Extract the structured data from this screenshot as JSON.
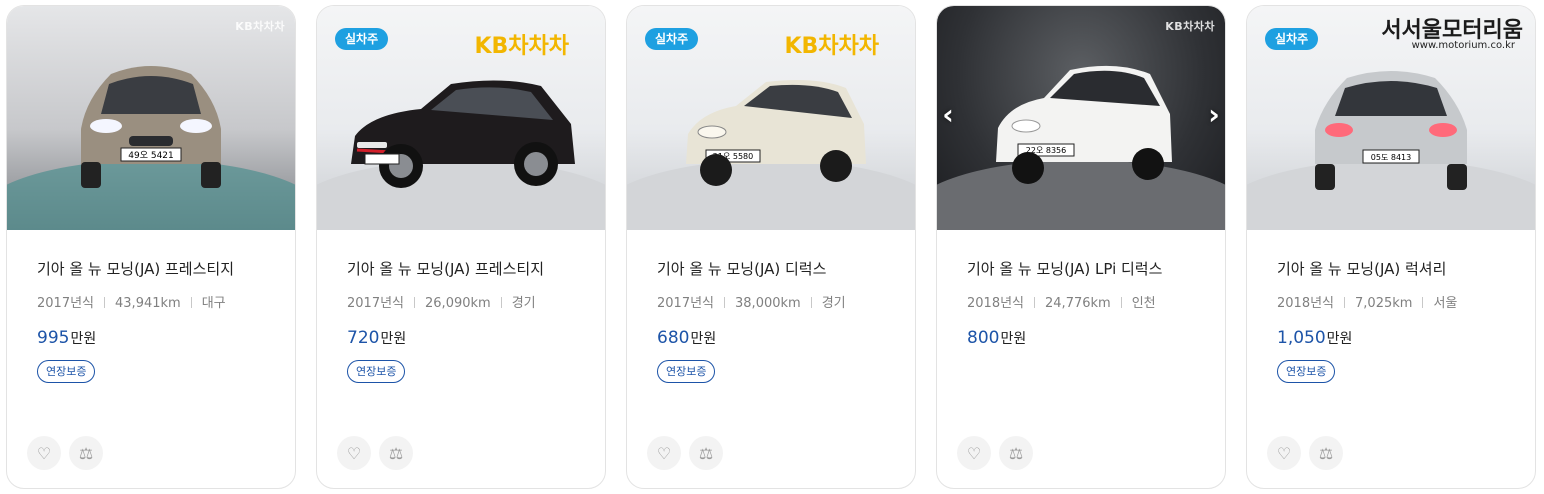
{
  "listings": [
    {
      "title": "기아 올 뉴 모닝(JA) 프레스티지",
      "year": "2017년식",
      "mileage": "43,941km",
      "region": "대구",
      "price": "995",
      "price_unit": "만원",
      "tag": "연장보증",
      "badge": "",
      "watermark": "KB차차차",
      "car_color": "#9a8f80",
      "plate": "49오 5421"
    },
    {
      "title": "기아 올 뉴 모닝(JA) 프레스티지",
      "year": "2017년식",
      "mileage": "26,090km",
      "region": "경기",
      "price": "720",
      "price_unit": "만원",
      "tag": "연장보증",
      "badge": "실차주",
      "watermark": "KB차차차",
      "car_color": "#1e1b1d"
    },
    {
      "title": "기아 올 뉴 모닝(JA) 디럭스",
      "year": "2017년식",
      "mileage": "38,000km",
      "region": "경기",
      "price": "680",
      "price_unit": "만원",
      "tag": "연장보증",
      "badge": "실차주",
      "watermark": "KB차차차",
      "car_color": "#e8e4d6",
      "plate": "21오 5580"
    },
    {
      "title": "기아 올 뉴 모닝(JA) LPi 디럭스",
      "year": "2018년식",
      "mileage": "24,776km",
      "region": "인천",
      "price": "800",
      "price_unit": "만원",
      "tag": "",
      "badge": "",
      "watermark": "KB차차차",
      "car_color": "#f3f3f2",
      "plate": "22오 8356"
    },
    {
      "title": "기아 올 뉴 모닝(JA) 럭셔리",
      "year": "2018년식",
      "mileage": "7,025km",
      "region": "서울",
      "price": "1,050",
      "price_unit": "만원",
      "tag": "연장보증",
      "badge": "실차주",
      "watermark": "서서울모터리움",
      "watermark_sub": "www.motorium.co.kr",
      "car_color": "#c6c9cc",
      "plate": "05도 8413"
    }
  ],
  "icons": {
    "favorite": "heart-icon",
    "compare": "scale-icon",
    "prev": "chevron-left-icon",
    "next": "chevron-right-icon"
  },
  "colors": {
    "accent": "#1d54a8",
    "badge": "#1ea0e1"
  }
}
